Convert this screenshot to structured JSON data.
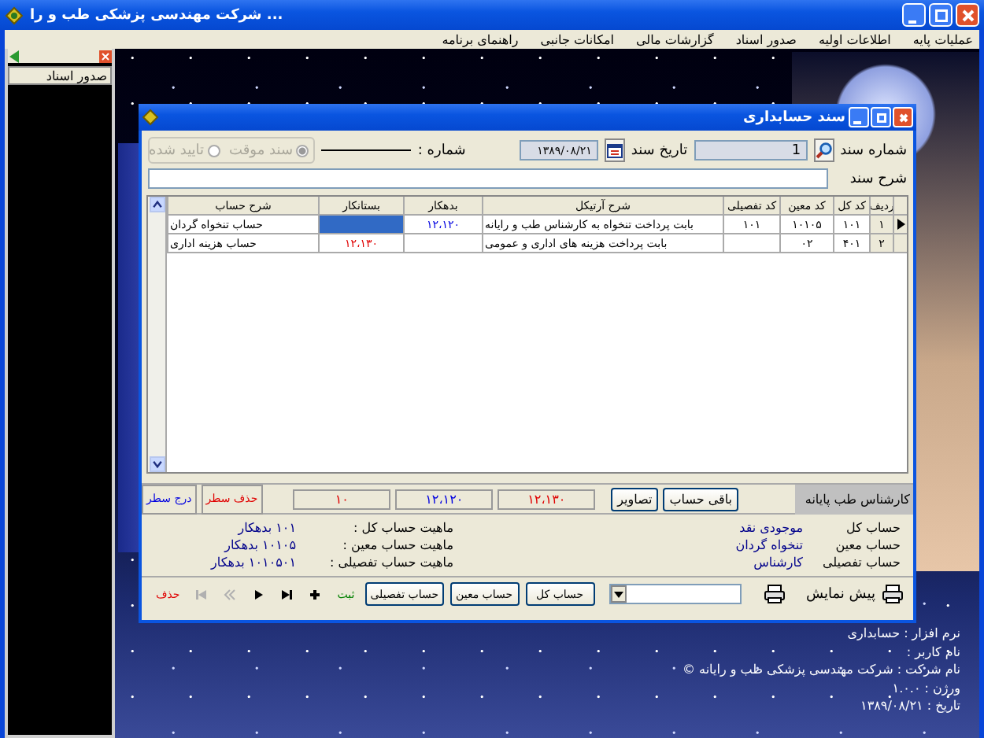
{
  "window": {
    "title": "شرکت مهندسی پزشکی طب و را ..."
  },
  "menu": [
    {
      "label": "عملیات پایه"
    },
    {
      "label": "اطلاعات اولیه"
    },
    {
      "label": "صدور اسناد"
    },
    {
      "label": "گزارشات مالی"
    },
    {
      "label": "امکانات جانبی"
    },
    {
      "label": "راهنمای برنامه"
    }
  ],
  "side_panel": {
    "items": [
      {
        "label": "صدور اسناد",
        "selected": false
      }
    ]
  },
  "dialog": {
    "title": "سند حسابداری",
    "doc_number_label": "شماره سند",
    "doc_number": "1",
    "date_label": "تاریخ سند",
    "date": "۱۳۸۹/۰۸/۲۱",
    "serial_label": "شماره :",
    "description_label": "شرح سند",
    "status_options": [
      {
        "label": "سند موقت",
        "selected": true,
        "disabled": true
      },
      {
        "label": "تایید شده",
        "selected": false,
        "disabled": true
      }
    ],
    "table": {
      "columns": [
        {
          "label": "ردیف",
          "kind": "row"
        },
        {
          "label": "کد کل",
          "kind": "code"
        },
        {
          "label": "کد معین",
          "kind": "code"
        },
        {
          "label": "کد تفصیلی",
          "kind": "code"
        },
        {
          "label": "شرح آرتیکل",
          "kind": "text"
        },
        {
          "label": "بدهکار",
          "kind": "debit"
        },
        {
          "label": "بستانکار",
          "kind": "credit"
        },
        {
          "label": "شرح حساب",
          "kind": "text"
        }
      ],
      "rows": [
        {
          "selected": true,
          "cells": [
            "۱",
            "۱۰۱",
            "۱۰۱۰۵",
            "۱۰۱",
            "بابت پرداخت تنخواه به کارشناس طب و رایانه",
            "۱۲،۱۲۰",
            null,
            "حساب تنخواه گردان"
          ]
        },
        {
          "selected": false,
          "cells": [
            "۲",
            "۴۰۱",
            "۰۲",
            null,
            "بابت پرداخت هزینه های اداری و عمومی",
            null,
            "۱۲،۱۳۰",
            "حساب هزینه اداری"
          ]
        }
      ]
    },
    "user_label": "کارشناس طب پایانه",
    "footer_buttons": [
      {
        "label": "باقی حساب"
      },
      {
        "label": "تصاویر"
      }
    ],
    "totals": [
      {
        "text": "۱۲،۱۳۰",
        "kind": "credit"
      },
      {
        "text": "۱۲،۱۲۰",
        "kind": "debit"
      },
      {
        "text": "۱۰",
        "kind": "difference"
      }
    ],
    "row_buttons": [
      {
        "label": "حذف سطر",
        "kind": "delete"
      },
      {
        "label": "درج سطر",
        "kind": "insert"
      }
    ],
    "account_info": [
      {
        "label": "حساب کل",
        "value": "موجودی نقد",
        "nature_label": "ماهیت حساب کل :",
        "nature": "۱۰۱ بدهکار"
      },
      {
        "label": "حساب معین",
        "value": "تنخواه گردان",
        "nature_label": "ماهیت حساب معین :",
        "nature": "۱۰۱۰۵ بدهکار"
      },
      {
        "label": "حساب تفصیلی",
        "value": "کارشناس",
        "nature_label": "ماهیت حساب تفصیلی :",
        "nature": "۱۰۱۰۵۰۱ بدهکار"
      }
    ],
    "preview_label": "پیش نمایش",
    "account_buttons": [
      {
        "label": "حساب کل"
      },
      {
        "label": "حساب معین"
      },
      {
        "label": "حساب تفصیلی"
      }
    ],
    "nav": [
      {
        "kind": "save",
        "label": "ثبت",
        "disabled": false
      },
      {
        "kind": "add",
        "disabled": false
      },
      {
        "kind": "last",
        "disabled": false
      },
      {
        "kind": "next",
        "disabled": false
      },
      {
        "kind": "previous",
        "disabled": true
      },
      {
        "kind": "first",
        "disabled": true
      },
      {
        "kind": "delete",
        "label": "حذف",
        "disabled": false
      }
    ]
  },
  "desktop_info": [
    {
      "label": "نرم افزار :",
      "value": "حسابداری"
    },
    {
      "label": "نام کاربر :"
    },
    {
      "label": "نام شرکت :",
      "value": "شرکت مهندسی پزشکی طب و رایانه ©"
    },
    {
      "label": "ورژن :",
      "value": "۱.۰.۰"
    },
    {
      "label": "تاریخ :",
      "value": "۱۳۸۹/۰۸/۲۱"
    }
  ]
}
